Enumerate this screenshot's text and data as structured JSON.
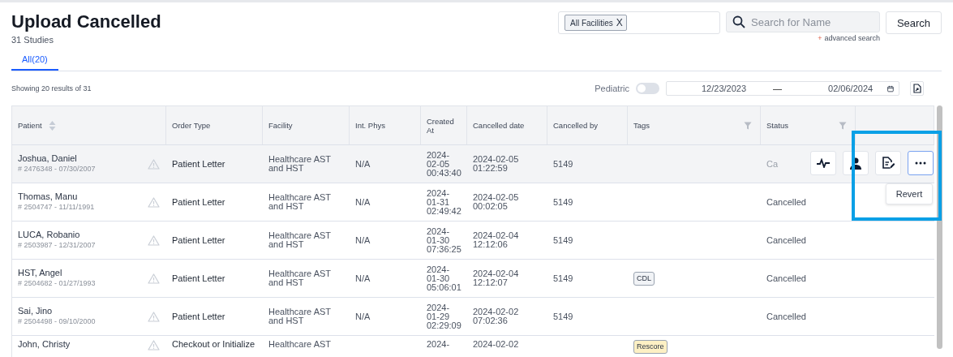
{
  "header": {
    "title": "Upload Cancelled",
    "subtitle": "31 Studies"
  },
  "tabs": [
    {
      "label": "All(20)",
      "selected": true
    }
  ],
  "facility_filter": {
    "chip": "All Facilities",
    "chip_close": "X"
  },
  "search": {
    "placeholder": "Search for Name",
    "button": "Search",
    "advanced_plus": "+",
    "advanced": "advanced search"
  },
  "results_text": "Showing 20 results of 31",
  "pediatric": {
    "label": "Pediatric",
    "on": false
  },
  "date_range": {
    "from": "12/23/2023",
    "separator": "—",
    "to": "02/06/2024"
  },
  "table": {
    "columns": [
      {
        "label": "Patient",
        "sortable": true,
        "filter": false
      },
      {
        "label": "Order Type",
        "sortable": false,
        "filter": false
      },
      {
        "label": "Facility",
        "sortable": false,
        "filter": false
      },
      {
        "label": "Int. Phys",
        "sortable": false,
        "filter": false
      },
      {
        "label": "Created At",
        "sortable": false,
        "filter": false
      },
      {
        "label": "Cancelled date",
        "sortable": false,
        "filter": false
      },
      {
        "label": "Cancelled by",
        "sortable": false,
        "filter": false
      },
      {
        "label": "Tags",
        "sortable": false,
        "filter": true
      },
      {
        "label": "Status",
        "sortable": false,
        "filter": true
      }
    ],
    "rows": [
      {
        "highlighted": true,
        "name": "Joshua, Daniel",
        "details": "# 2476348 - 07/30/2007",
        "order_type": "Patient Letter",
        "facility": "Healthcare AST and HST",
        "int_phys": "N/A",
        "created_at": "2024-\n02-05\n00:43:40",
        "cancelled_date": "2024-02-05\n01:22:59",
        "cancelled_by": "5149",
        "tags": [],
        "status": "Ca",
        "actions": {
          "menu": "Revert"
        }
      },
      {
        "highlighted": false,
        "name": "Thomas, Manu",
        "details": "# 2504747 - 11/11/1991",
        "order_type": "Patient Letter",
        "facility": "Healthcare AST and HST",
        "int_phys": "N/A",
        "created_at": "2024-\n01-31\n02:49:42",
        "cancelled_date": "2024-02-05\n00:02:05",
        "cancelled_by": "5149",
        "tags": [],
        "status": "Cancelled"
      },
      {
        "highlighted": false,
        "name": "LUCA, Robanio",
        "details": "# 2503987 - 12/31/2007",
        "order_type": "Patient Letter",
        "facility": "Healthcare AST and HST",
        "int_phys": "N/A",
        "created_at": "2024-\n01-30\n07:36:25",
        "cancelled_date": "2024-02-04\n12:12:06",
        "cancelled_by": "5149",
        "tags": [],
        "status": "Cancelled"
      },
      {
        "highlighted": false,
        "name": "HST, Angel",
        "details": "# 2504682 - 01/27/1993",
        "order_type": "Patient Letter",
        "facility": "Healthcare AST and HST",
        "int_phys": "N/A",
        "created_at": "2024-\n01-30\n05:06:01",
        "cancelled_date": "2024-02-04\n12:12:07",
        "cancelled_by": "5149",
        "tags": [
          {
            "label": "CDL",
            "color": "#f1f3f6"
          }
        ],
        "status": "Cancelled"
      },
      {
        "highlighted": false,
        "name": "Sai, Jino",
        "details": "# 2504498 - 09/10/2000",
        "order_type": "Patient Letter",
        "facility": "Healthcare AST and HST",
        "int_phys": "N/A",
        "created_at": "2024-\n01-29\n02:29:09",
        "cancelled_date": "2024-02-02\n07:02:36",
        "cancelled_by": "5149",
        "tags": [],
        "status": "Cancelled"
      },
      {
        "highlighted": false,
        "name": "John, Christy",
        "order_type": "Checkout or Initialize",
        "facility": "Healthcare AST",
        "created_at": "2024-",
        "cancelled_date": "2024-02-02",
        "tags": [
          {
            "label": "Rescore",
            "color": "#fdf0c4"
          }
        ]
      }
    ]
  }
}
